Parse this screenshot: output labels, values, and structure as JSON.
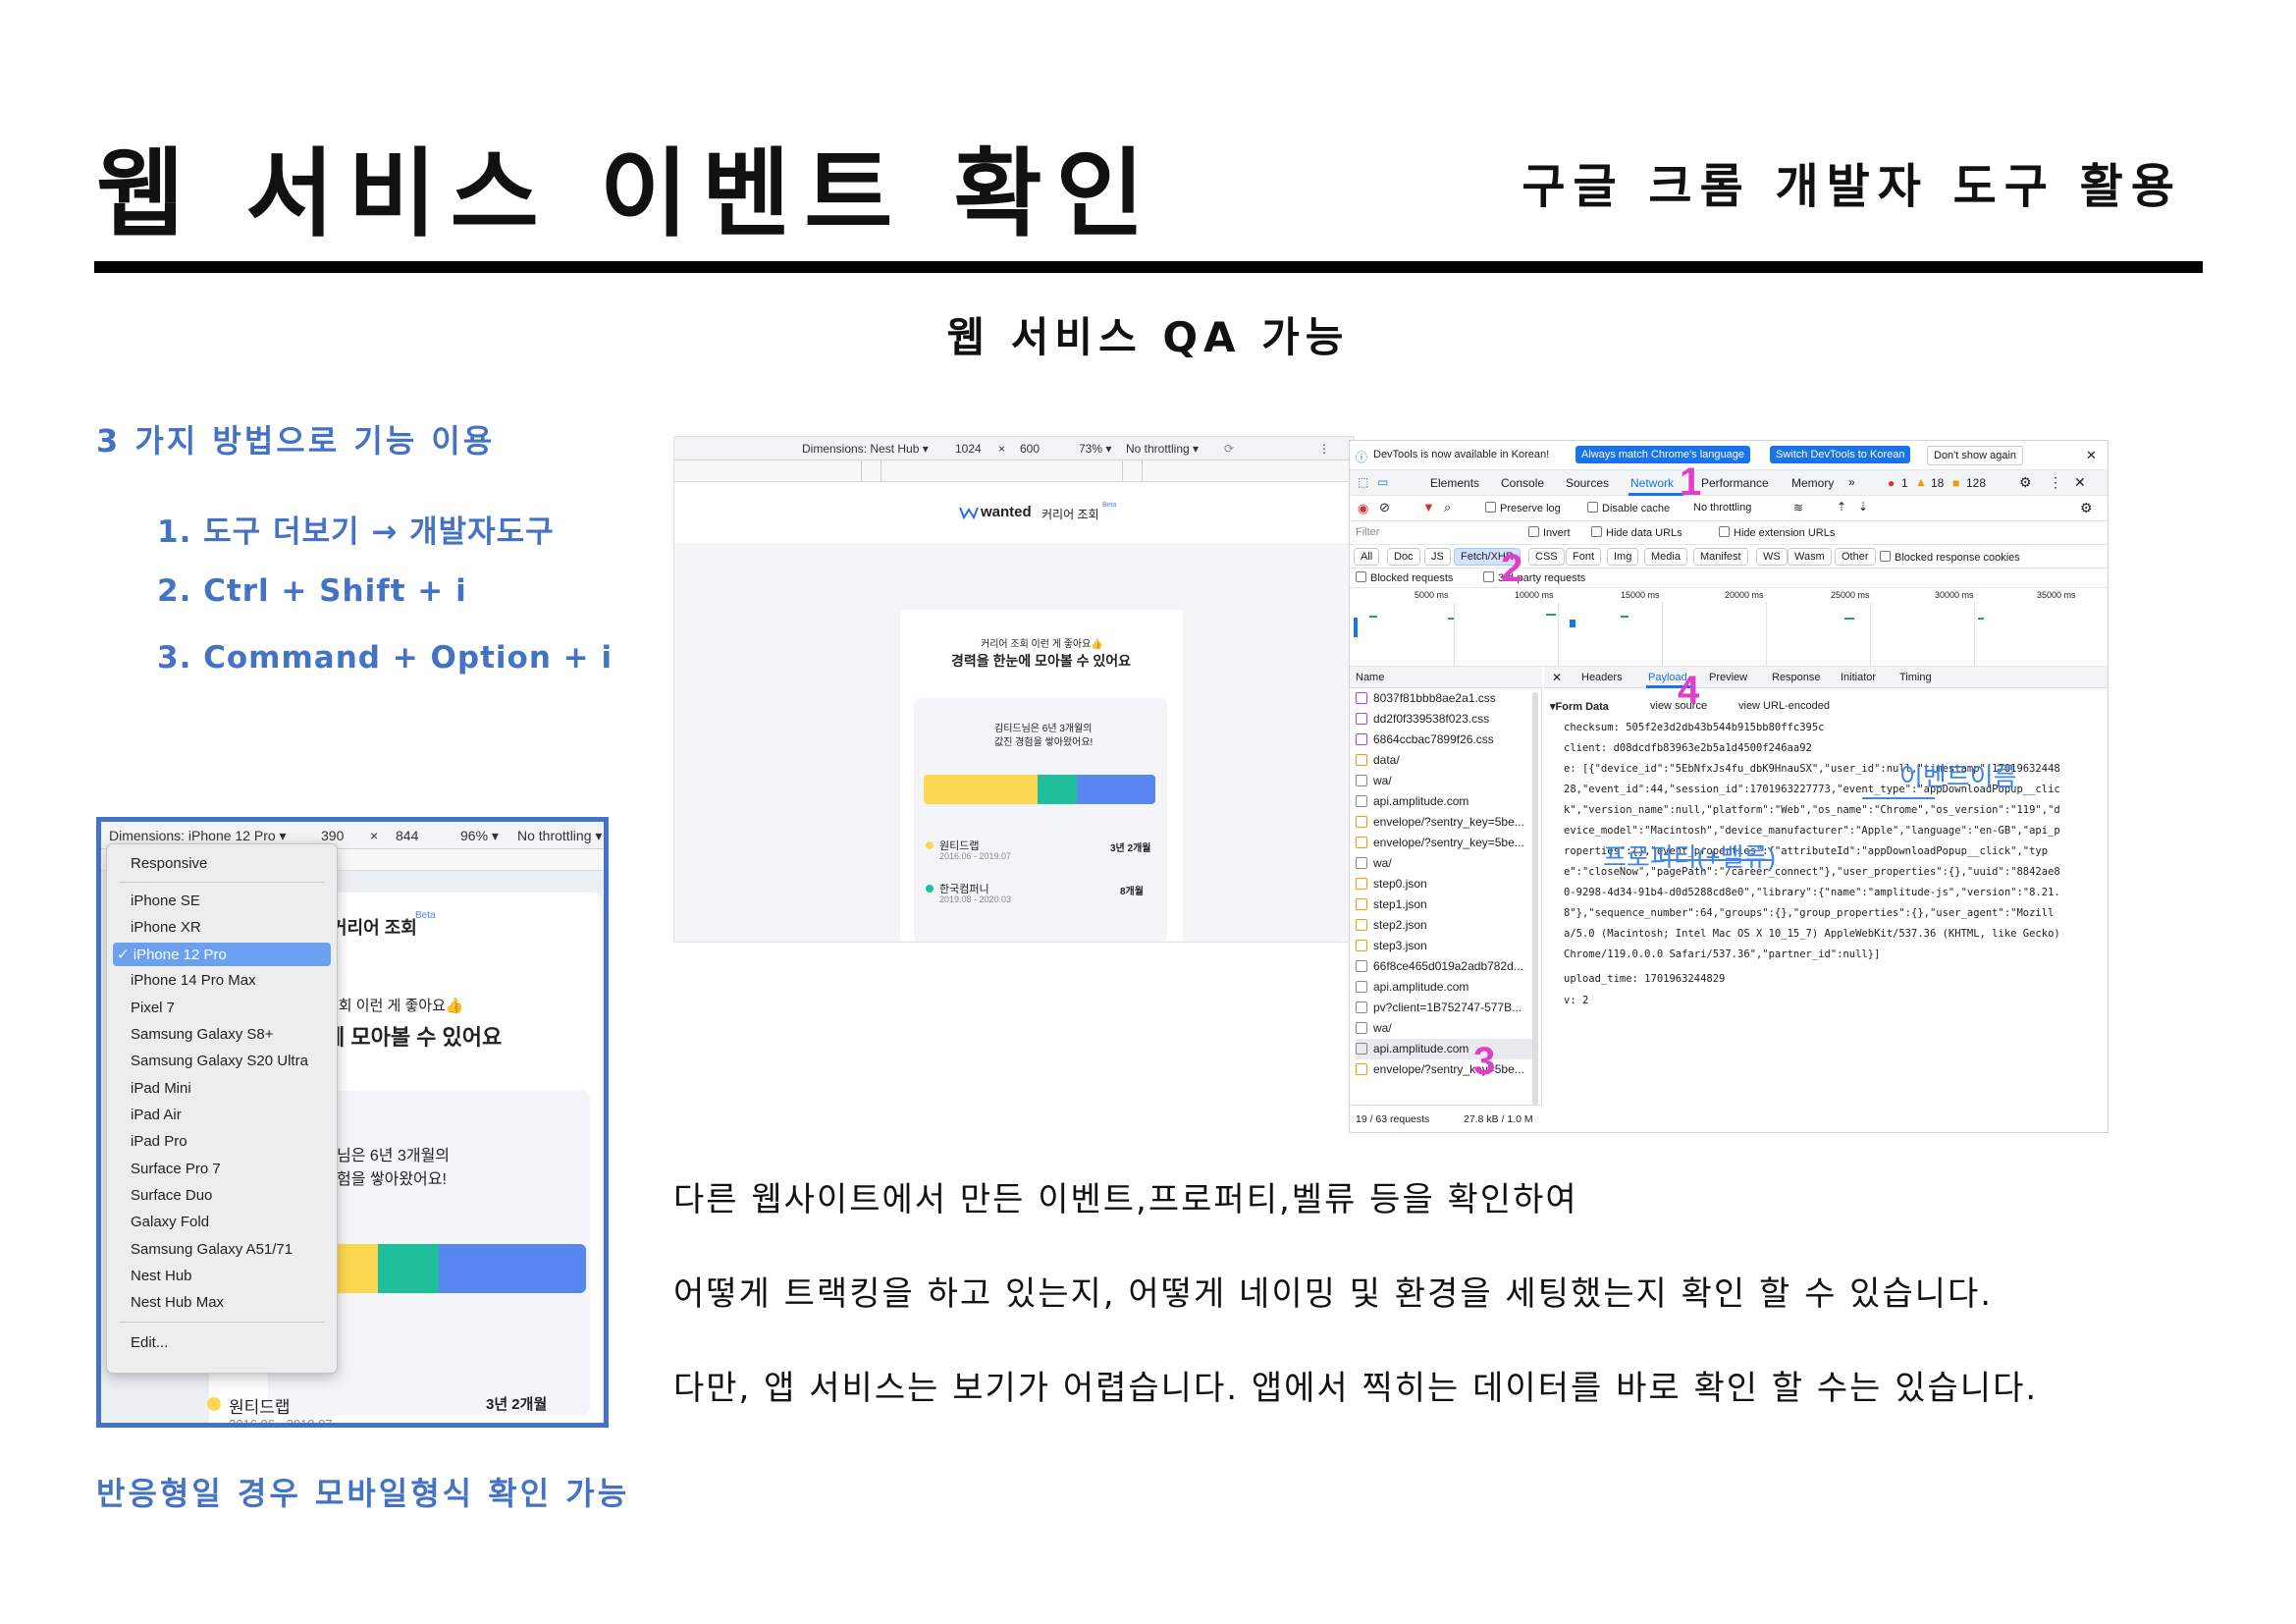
{
  "header": {
    "title": "웹 서비스 이벤트 확인",
    "subtitle": "구글 크롬 개발자 도구 활용"
  },
  "section_heading": "웹 서비스 QA 가능",
  "methods": {
    "title": "3 가지 방법으로 기능 이용",
    "items": [
      "1.  도구 더보기 → 개발자도구",
      "2.  Ctrl + Shift + i",
      "3.  Command + Option + i"
    ]
  },
  "mobile_caption": "반응형일 경우 모바일형식 확인 가능",
  "mobile_toolbar": {
    "dimensions": "Dimensions: iPhone 12 Pro ▾",
    "width": "390",
    "x": "×",
    "height": "844",
    "zoom": "96% ▾",
    "throttle": "No throttling ▾"
  },
  "device_menu": {
    "items": [
      "Responsive",
      "iPhone SE",
      "iPhone XR",
      "✓ iPhone 12 Pro",
      "iPhone 14 Pro Max",
      "Pixel 7",
      "Samsung Galaxy S8+",
      "Samsung Galaxy S20 Ultra",
      "iPad Mini",
      "iPad Air",
      "iPad Pro",
      "Surface Pro 7",
      "Surface Duo",
      "Galaxy Fold",
      "Samsung Galaxy A51/71",
      "Nest Hub",
      "Nest Hub Max",
      "Edit..."
    ]
  },
  "mobile_page": {
    "brand": "커리어 조회",
    "beta": "Beta",
    "headline1": "조회 이런 게 좋아요👍",
    "headline2": "에 모아볼 수 있어요",
    "exp1": "님은 6년 3개월의",
    "exp2": "험을 쌓아왔어요!",
    "company": "원티드랩",
    "period": "2016.06 - 2019.07",
    "duration": "3년 2개월"
  },
  "browser": {
    "toolbar": {
      "dimensions": "Dimensions: Nest Hub ▾",
      "width": "1024",
      "x": "×",
      "height": "600",
      "zoom": "73% ▾",
      "throttle": "No throttling ▾"
    },
    "brand": "wanted",
    "brand_sub": "커리어 조회",
    "beta": "Beta",
    "headline1": "커리어 조회 이런 게 좋아요👍",
    "headline2": "경력을 한눈에 모아볼 수 있어요",
    "exp1": "김티드님은 6년 3개월의",
    "exp2": "값진 경험을 쌓아왔어요!",
    "company1": "원티드랩",
    "period1": "2016.06 - 2019.07",
    "duration1": "3년 2개월",
    "company2": "한국컴퍼니",
    "period2": "2019.08 - 2020.03",
    "duration2": "8개월",
    "bar_colors": [
      "#fcd850",
      "#1fbf9b",
      "#5a86f2"
    ]
  },
  "devtools": {
    "banner": {
      "text": "DevTools is now available in Korean!",
      "btn1": "Always match Chrome's language",
      "btn2": "Switch DevTools to Korean",
      "btn3": "Don't show again",
      "close": "✕"
    },
    "tabs": [
      "Elements",
      "Console",
      "Sources",
      "Network",
      "Performance",
      "Memory",
      "»"
    ],
    "counts": {
      "errors": "1",
      "warnings": "18",
      "info": "128"
    },
    "toolbar": {
      "preserve": "Preserve log",
      "disable_cache": "Disable cache",
      "throttle": "No throttling"
    },
    "filter": {
      "placeholder": "Filter",
      "invert": "Invert",
      "hide_data": "Hide data URLs",
      "hide_ext": "Hide extension URLs"
    },
    "types": [
      "All",
      "Doc",
      "JS",
      "Fetch/XHR",
      "CSS",
      "Font",
      "Img",
      "Media",
      "Manifest",
      "WS",
      "Wasm",
      "Other"
    ],
    "blocked_cookies": "Blocked response cookies",
    "blocked_requests": "Blocked requests",
    "third_party": "3rd-party requests",
    "timeline": [
      "5000 ms",
      "10000 ms",
      "15000 ms",
      "20000 ms",
      "25000 ms",
      "30000 ms",
      "35000 ms"
    ],
    "name_header": "Name",
    "requests": [
      "8037f81bbb8ae2a1.css",
      "dd2f0f339538f023.css",
      "6864ccbac7899f26.css",
      "data/",
      "wa/",
      "api.amplitude.com",
      "envelope/?sentry_key=5be...",
      "envelope/?sentry_key=5be...",
      "wa/",
      "step0.json",
      "step1.json",
      "step2.json",
      "step3.json",
      "66f8ce465d019a2adb782d...",
      "api.amplitude.com",
      "pv?client=1B752747-577B...",
      "wa/",
      "api.amplitude.com",
      "envelope/?sentry_key=5be..."
    ],
    "status": {
      "requests": "19 / 63 requests",
      "size": "27.8 kB / 1.0 M"
    },
    "detail_tabs": [
      "Headers",
      "Payload",
      "Preview",
      "Response",
      "Initiator",
      "Timing"
    ],
    "form_data": "▾Form Data",
    "view_source": "view source",
    "view_url": "view URL-encoded",
    "payload_lines": [
      "checksum: 505f2e3d2db43b544b915bb80ffc395c",
      "client: d08dcdfb83963e2b5a1d4500f246aa92",
      "e: [{\"device_id\":\"5EbNfxJs4fu_dbK9HnauSX\",\"user_id\":null,\"timestamp\":17019632448",
      "28,\"event_id\":44,\"session_id\":1701963227773,\"event_type\":\"appDownloadPopup__clic",
      "k\",\"version_name\":null,\"platform\":\"Web\",\"os_name\":\"Chrome\",\"os_version\":\"119\",\"d",
      "evice_model\":\"Macintosh\",\"device_manufacturer\":\"Apple\",\"language\":\"en-GB\",\"api_p",
      "roperties\":{},\"event_properties\":{\"attributeId\":\"appDownloadPopup__click\",\"typ",
      "e\":\"closeNow\",\"pagePath\":\"/career_connect\"},\"user_properties\":{},\"uuid\":\"8842ae8",
      "0-9298-4d34-91b4-d0d5288cd8e0\",\"library\":{\"name\":\"amplitude-js\",\"version\":\"8.21.",
      "8\"},\"sequence_number\":64,\"groups\":{},\"group_properties\":{},\"user_agent\":\"Mozill",
      "a/5.0 (Macintosh; Intel Mac OS X 10_15_7) AppleWebKit/537.36 (KHTML, like Gecko)",
      "Chrome/119.0.0.0 Safari/537.36\",\"partner_id\":null}]",
      "upload_time: 1701963244829",
      "v: 2"
    ],
    "annotations": {
      "n1": "1",
      "n2": "2",
      "n3": "3",
      "n4": "4",
      "event_name": "이벤트이름",
      "property": "프로퍼티(+밸류)"
    }
  },
  "descriptions": [
    "다른 웹사이트에서 만든 이벤트,프로퍼티,벨류 등을 확인하여",
    "어떻게 트랙킹을 하고 있는지, 어떻게 네이밍 및 환경을 세팅했는지 확인 할 수 있습니다.",
    "다만, 앱 서비스는 보기가 어렵습니다. 앱에서 찍히는 데이터를 바로 확인 할 수는 있습니다."
  ],
  "colors": {
    "accent_blue": "#4472c4",
    "annotation_pink": "#e040c8",
    "annotation_blue": "#3f86e6"
  }
}
